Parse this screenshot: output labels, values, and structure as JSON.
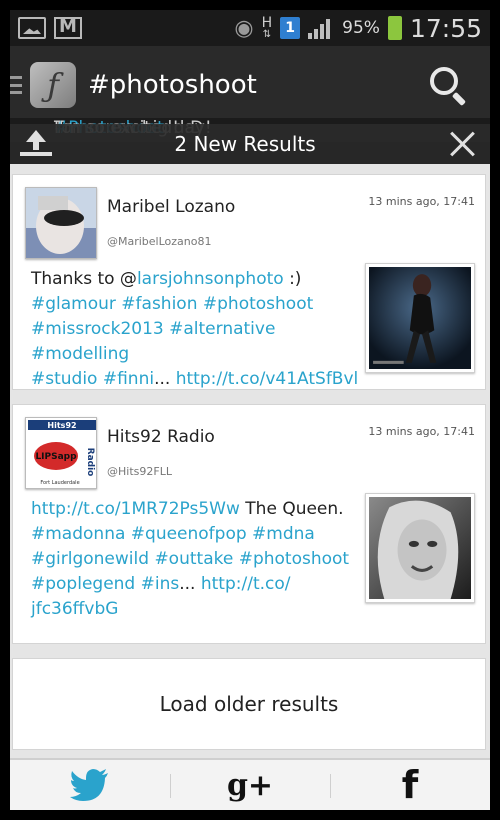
{
  "status_bar": {
    "battery_percent": "95%",
    "time": "17:55",
    "sim_label": "1",
    "network_type": "H",
    "icons": [
      "image-icon",
      "gmail-icon",
      "eye-icon",
      "data-arrows-icon",
      "sim-icon",
      "signal-icon",
      "battery-icon"
    ]
  },
  "action_bar": {
    "title": "#photoshoot",
    "icons": [
      "menu-icon",
      "app-logo-icon",
      "search-icon"
    ]
  },
  "peek": {
    "text_before": "Tomorrow big day! ",
    "tag": "#Photoshoot",
    "text_after": " I'm so excited! :D"
  },
  "new_results_bar": {
    "label": "2 New Results",
    "icons": [
      "upload-icon",
      "close-icon"
    ]
  },
  "tweets": [
    {
      "name": "Maribel Lozano",
      "handle": "@MaribelLozano81",
      "time": "13 mins ago, 17:41",
      "text_plain_1": "Thanks to @",
      "mention": "larsjohnsonphoto",
      "text_plain_2": " :)",
      "hashtags_1": "#glamour #fashion #photoshoot",
      "hashtags_2": "#missrock2013 #alternative #modelling",
      "hashtags_3a": "#studio #finni",
      "ellipsis": "...",
      "link": "http://t.co/v41AtSfBvl"
    },
    {
      "name": "Hits92 Radio",
      "handle": "@Hits92FLL",
      "time": "13 mins ago, 17:41",
      "link_1": "http://t.co/1MR72Ps5Ww",
      "text_plain_1": " The Queen.",
      "hashtags_1": "#madonna #queenofpop #mdna",
      "hashtags_2": "#girlgonewild #outtake #photoshoot",
      "hashtags_3a": "#poplegend #ins",
      "ellipsis": "...",
      "link_2a": "http://t.co/",
      "link_2b": "jfc36ffvbG",
      "avatar_text_top": "Hits92",
      "avatar_text_main": "LIPSapp",
      "avatar_text_side": "Radio",
      "avatar_text_bottom": "Fort Lauderdale"
    }
  ],
  "load_older_label": "Load older results",
  "share_bar": {
    "twitter_icon": "twitter-bird-icon",
    "gplus_label": "g+",
    "facebook_label": "f"
  },
  "colors": {
    "link": "#2aa3cc",
    "bar_dark": "#2a2a2a",
    "battery": "#8cc63e",
    "sim": "#2f7fd0",
    "twitter": "#2aa3cc"
  }
}
